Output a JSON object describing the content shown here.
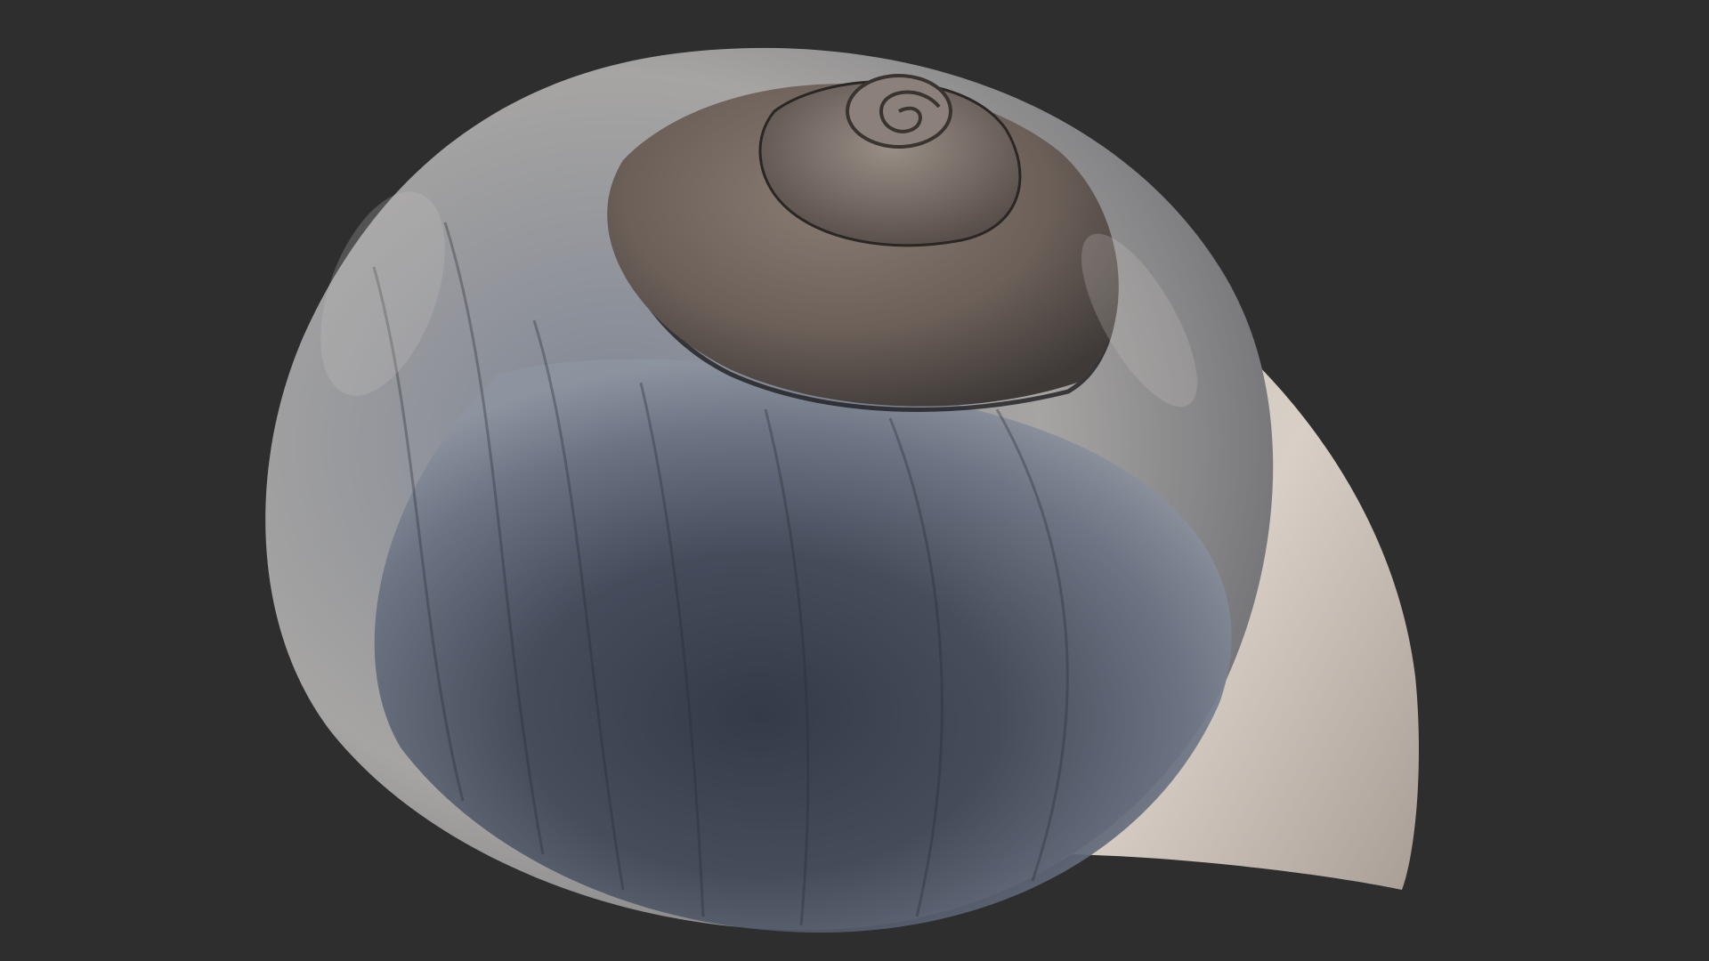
{
  "scene": {
    "subject": "snail-shell",
    "colors": {
      "background": "#2e2e2f",
      "shell_dark": "#2b3240",
      "shell_mid": "#5a6372",
      "shell_blue_gray": "#7d8594",
      "shell_light": "#b9b1a8",
      "lip_cream": "#d8cfc6",
      "spire_brown": "#6b5f58",
      "suture_line": "#1e1d1f"
    }
  }
}
